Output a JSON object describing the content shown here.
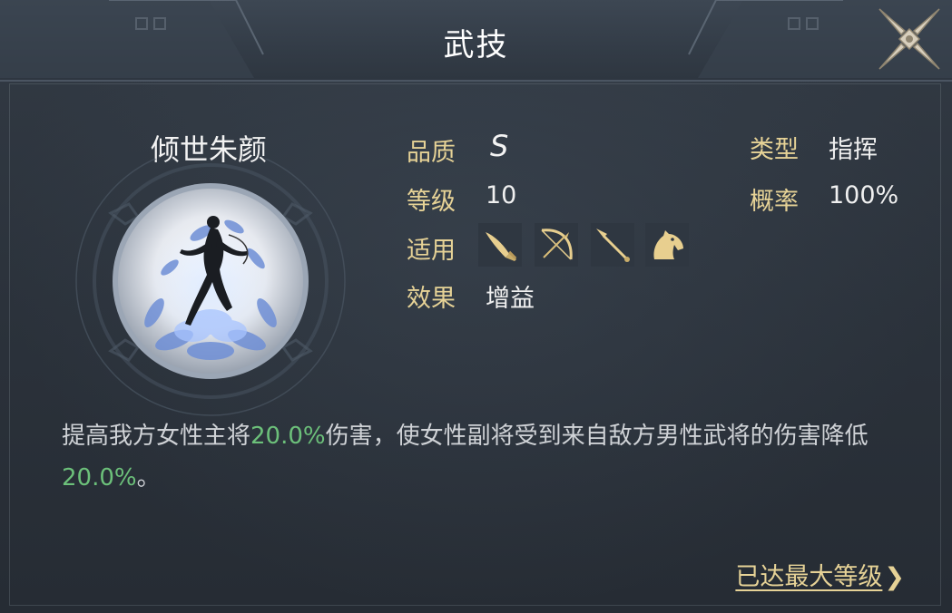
{
  "header": {
    "title": "武技"
  },
  "skill": {
    "name": "倾世朱颜",
    "quality_label": "品质",
    "quality_value": "S",
    "level_label": "等级",
    "level_value": "10",
    "applicable_label": "适用",
    "applicable_units": [
      "sword-icon",
      "bow-icon",
      "spear-icon",
      "horse-icon"
    ],
    "effect_label": "效果",
    "effect_value": "增益",
    "type_label": "类型",
    "type_value": "指挥",
    "chance_label": "概率",
    "chance_value": "100%"
  },
  "description": {
    "part1": "提高我方女性主将",
    "value1": "20.0%",
    "part2": "伤害，使女性副将受到来自敌方男性武将的伤害降低",
    "value2": "20.0%",
    "part3": "。"
  },
  "footer": {
    "max_level_link": "已达最大等级",
    "arrow": "❯"
  },
  "colors": {
    "label_gold": "#e6d296",
    "highlight_green": "#6cc07a",
    "panel": "#2b323b"
  }
}
